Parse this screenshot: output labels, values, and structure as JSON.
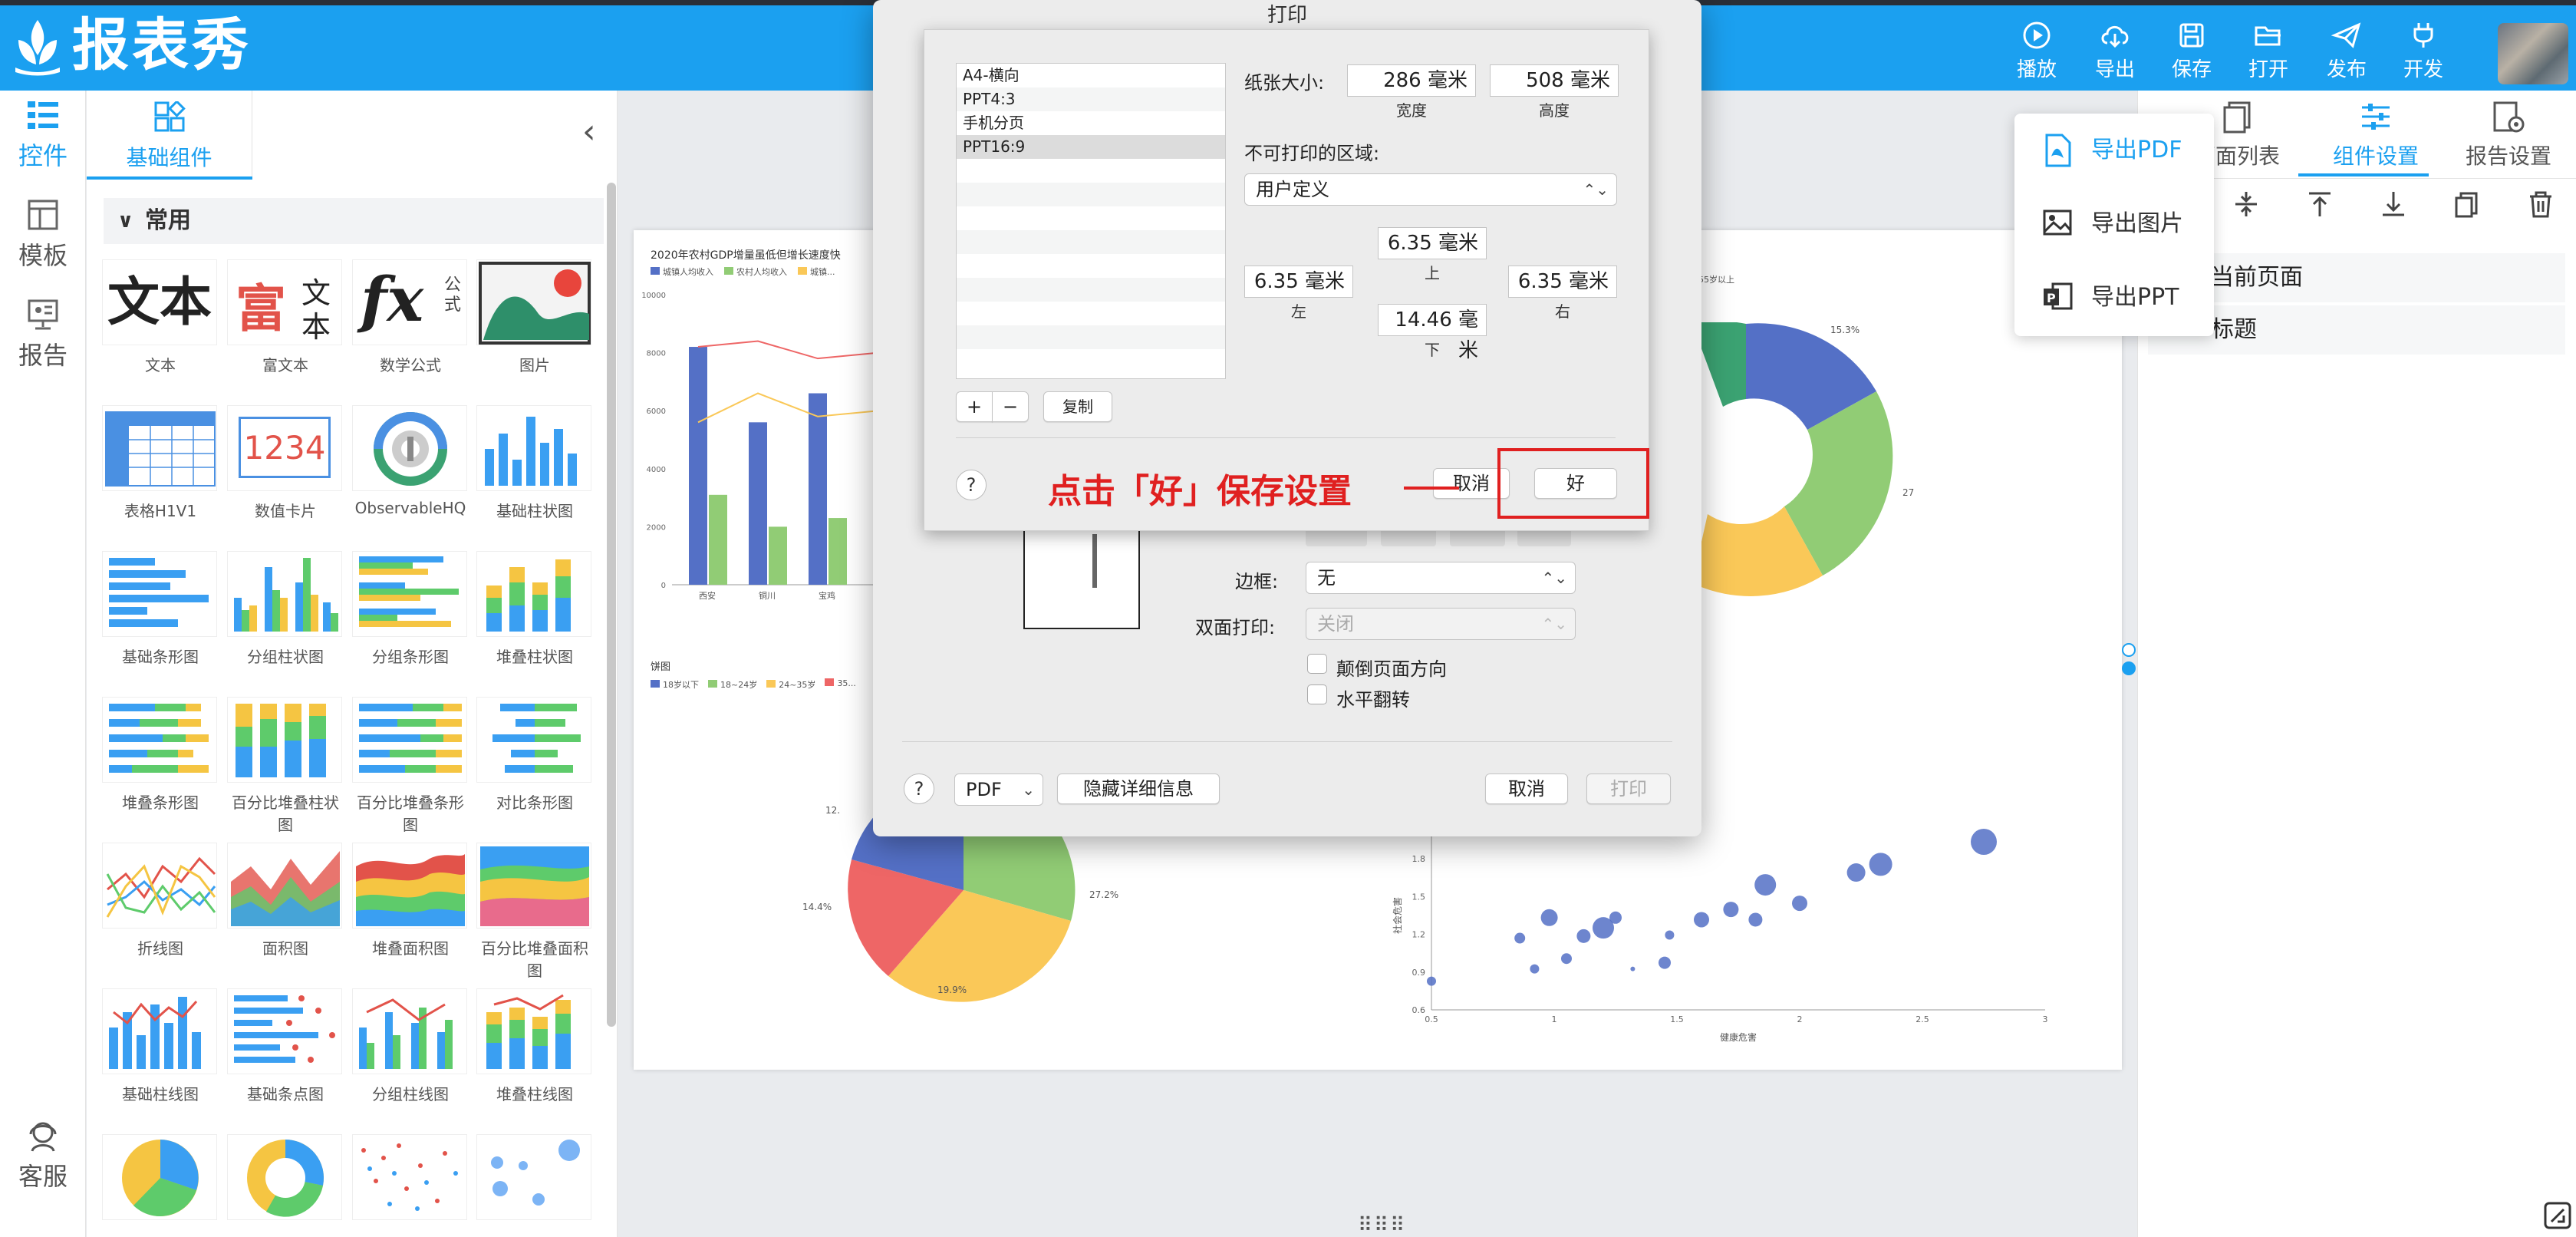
{
  "app": {
    "brand": "报表秀"
  },
  "toolbar": [
    {
      "label": "播放",
      "icon": "play-icon"
    },
    {
      "label": "导出",
      "icon": "cloud-download-icon"
    },
    {
      "label": "保存",
      "icon": "save-icon"
    },
    {
      "label": "打开",
      "icon": "folder-open-icon"
    },
    {
      "label": "发布",
      "icon": "send-icon"
    },
    {
      "label": "开发",
      "icon": "plug-icon"
    }
  ],
  "rail": [
    {
      "label": "控件",
      "icon": "widgets-icon",
      "active": true
    },
    {
      "label": "模板",
      "icon": "template-icon",
      "active": false
    },
    {
      "label": "报告",
      "icon": "report-icon",
      "active": false
    },
    {
      "label": "客服",
      "icon": "support-icon",
      "active": false
    }
  ],
  "components": {
    "tab_label": "基础组件",
    "section": "常用",
    "items": [
      {
        "label": "文本"
      },
      {
        "label": "富文本"
      },
      {
        "label": "数学公式"
      },
      {
        "label": "图片"
      },
      {
        "label": "表格H1V1"
      },
      {
        "label": "数值卡片"
      },
      {
        "label": "ObservableHQ"
      },
      {
        "label": "基础柱状图"
      },
      {
        "label": "基础条形图"
      },
      {
        "label": "分组柱状图"
      },
      {
        "label": "分组条形图"
      },
      {
        "label": "堆叠柱状图"
      },
      {
        "label": "堆叠条形图"
      },
      {
        "label": "百分比堆叠柱状图"
      },
      {
        "label": "百分比堆叠条形图"
      },
      {
        "label": "对比条形图"
      },
      {
        "label": "折线图"
      },
      {
        "label": "面积图"
      },
      {
        "label": "堆叠面积图"
      },
      {
        "label": "百分比堆叠面积图"
      },
      {
        "label": "基础柱线图"
      },
      {
        "label": "基础条点图"
      },
      {
        "label": "分组柱线图"
      },
      {
        "label": "堆叠柱线图"
      }
    ],
    "thumb_text": {
      "text": "文本",
      "rich1": "富",
      "rich2": "文",
      "rich3": "本",
      "formula": "fx",
      "formula_sub": "公式",
      "card_value": "1234"
    }
  },
  "right_panel": {
    "tabs": [
      {
        "label": "页面列表",
        "icon": "pages-icon"
      },
      {
        "label": "组件设置",
        "icon": "sliders-icon"
      },
      {
        "label": "报告设置",
        "icon": "report-gear-icon"
      }
    ],
    "rows": [
      "当前页面",
      "标题"
    ]
  },
  "export_menu": [
    {
      "label": "导出PDF",
      "icon": "pdf-icon",
      "active": true
    },
    {
      "label": "导出图片",
      "icon": "image-icon",
      "active": false
    },
    {
      "label": "导出PPT",
      "icon": "ppt-icon",
      "active": false
    }
  ],
  "print_dialog": {
    "title": "打印",
    "paper_list": [
      "A4-横向",
      "PPT4:3",
      "手机分页",
      "PPT16:9"
    ],
    "selected_paper": "PPT16:9",
    "add_label": "+",
    "remove_label": "−",
    "copy_label": "复制",
    "paper_size_label": "纸张大小:",
    "width_value": "286 毫米",
    "width_label": "宽度",
    "height_value": "508 毫米",
    "height_label": "高度",
    "margin_label": "不可打印的区域:",
    "margin_select": "用户定义",
    "top_value": "6.35 毫米",
    "top_label": "上",
    "left_value": "6.35 毫米",
    "left_label": "左",
    "right_value": "6.35 毫米",
    "right_label": "右",
    "bottom_value": "14.46 毫米",
    "bottom_label": "下",
    "help": "?",
    "sheet_cancel": "取消",
    "sheet_ok": "好",
    "border_label": "边框:",
    "border_value": "无",
    "duplex_label": "双面打印:",
    "duplex_value": "关闭",
    "reverse_label": "颠倒页面方向",
    "flip_label": "水平翻转",
    "pdf_label": "PDF",
    "hide_details": "隐藏详细信息",
    "cancel": "取消",
    "print": "打印"
  },
  "annotation": "点击「好」保存设置",
  "chart_data": [
    {
      "type": "bar",
      "title": "2020年农村GDP增量虽低但增长速度快",
      "legend": [
        "城镇人均收入",
        "农村人均收入",
        "城镇..."
      ],
      "categories": [
        "西安",
        "铜川",
        "宝鸡"
      ],
      "series": [
        {
          "name": "城镇人均收入",
          "values": [
            8200,
            5600,
            6600
          ]
        },
        {
          "name": "农村人均收入",
          "values": [
            3100,
            2000,
            2300
          ]
        }
      ],
      "y_ticks": [
        "0",
        "2000",
        "4000",
        "6000",
        "8000",
        "10000"
      ],
      "ylim": [
        0,
        10000
      ]
    },
    {
      "type": "pie",
      "title": "饼图",
      "legend": [
        "18岁以下",
        "18~24岁",
        "24~35岁",
        "35..."
      ],
      "labels_visible": [
        "27.2%",
        "19.9%",
        "14.4%",
        "12."
      ]
    },
    {
      "type": "pie",
      "subtitle": "55岁以上",
      "labels_visible": [
        "15.3%",
        "27.2%"
      ]
    },
    {
      "type": "scatter",
      "xlabel": "健康危害",
      "ylabel": "社会危害",
      "x_ticks": [
        "0.5",
        "1",
        "1.5",
        "2",
        "2.5",
        "3"
      ],
      "y_ticks": [
        "0.6",
        "0.9",
        "1.2",
        "1.5",
        "1.8"
      ],
      "xlim": [
        0.5,
        3
      ],
      "ylim": [
        0.6,
        2.0
      ]
    }
  ],
  "colors": {
    "brand": "#1ba0f0",
    "accent_red": "#e02020",
    "chart_blue": "#5470c6",
    "chart_green": "#91cc75",
    "chart_yellow": "#fac858",
    "chart_red": "#ee6666",
    "chart_teal": "#3ba272"
  }
}
